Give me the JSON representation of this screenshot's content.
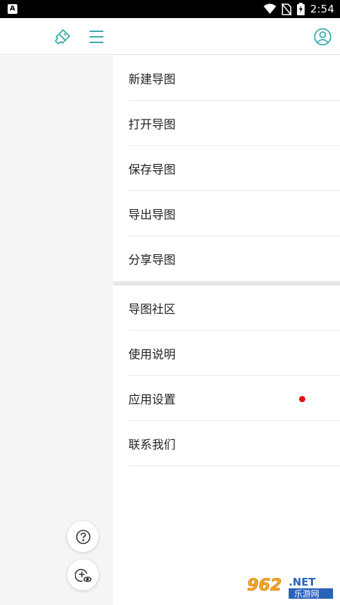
{
  "status_bar": {
    "left_badge": "A",
    "time": "2:54"
  },
  "toolbar": {
    "brush_icon": "brush-icon",
    "menu_icon": "hamburger-icon",
    "account_icon": "account-circle-icon",
    "accent_color": "#3aa9a9"
  },
  "menu": {
    "group1": [
      {
        "label": "新建导图"
      },
      {
        "label": "打开导图"
      },
      {
        "label": "保存导图"
      },
      {
        "label": "导出导图"
      },
      {
        "label": "分享导图"
      }
    ],
    "group2": [
      {
        "label": "导图社区"
      },
      {
        "label": "使用说明"
      },
      {
        "label": "应用设置",
        "badge": "red-dot"
      },
      {
        "label": "联系我们"
      }
    ]
  },
  "fabs": {
    "help_icon": "help-icon",
    "add_view_icon": "add-view-icon"
  },
  "watermark": {
    "number": "962",
    "domain": ".NET",
    "name": "乐游网"
  }
}
